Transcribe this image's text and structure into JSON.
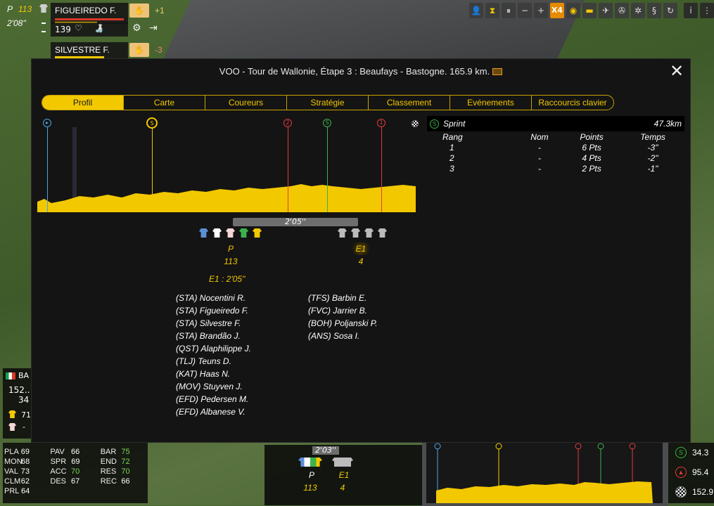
{
  "hud": {
    "group_label": "P",
    "group_count": "113",
    "gap_time": "2'08''",
    "rider1_name": "FIGUEIREDO F.",
    "rider1_delta": "+1",
    "rider1_energy": "139",
    "rider2_name": "SILVESTRE F.",
    "rider2_delta": "-3"
  },
  "toolbar": {
    "speed_label": "X4"
  },
  "dialog": {
    "title": "VOO - Tour de Wallonie, Étape 3 : Beaufays - Bastogne. 165.9 km."
  },
  "tabs": [
    {
      "label": "Profil",
      "active": true
    },
    {
      "label": "Carte",
      "active": false
    },
    {
      "label": "Coureurs",
      "active": false
    },
    {
      "label": "Stratégie",
      "active": false
    },
    {
      "label": "Classement",
      "active": false
    },
    {
      "label": "Evénements",
      "active": false
    },
    {
      "label": "Raccourcis clavier",
      "active": false
    }
  ],
  "profile": {
    "markers": [
      {
        "glyph": "▸",
        "color": "#4aa3e0"
      },
      {
        "glyph": "S",
        "color": "#f2c800"
      },
      {
        "glyph": "2",
        "color": "#e23b3b"
      },
      {
        "glyph": "S",
        "color": "#3bb34a"
      },
      {
        "glyph": "1",
        "color": "#e23b3b"
      }
    ],
    "gap_bar": "2'05''",
    "group_p_label": "P",
    "group_p_count": "113",
    "group_e1_label": "E1",
    "group_e1_count": "4",
    "e1_caption": "E1 : 2'05''",
    "group_p_jersey_colors": [
      "#5b8fd4",
      "#ffffff",
      "#f4d6d6",
      "#3bb34a",
      "#f2c800"
    ],
    "group_e1_jersey_colors": [
      "#bbbbbb",
      "#bbbbbb",
      "#bbbbbb",
      "#bbbbbb"
    ]
  },
  "riders_left": [
    "(STA) Nocentini R.",
    "(STA) Figueiredo F.",
    "(STA) Silvestre F.",
    "(STA) Brandão J.",
    "(QST) Alaphilippe J.",
    "(TLJ) Teuns D.",
    "(KAT) Haas N.",
    "(MOV) Stuyven J.",
    "(EFD) Pedersen M.",
    "(EFD) Albanese V."
  ],
  "riders_right": [
    "(TFS) Barbin E.",
    "(FVC) Jarrier B.",
    "(BOH) Poljanski P.",
    "(ANS) Sosa I."
  ],
  "sprint": {
    "title": "Sprint",
    "km": "47.3km",
    "headers": [
      "Rang",
      "Nom",
      "Points",
      "Temps"
    ],
    "rows": [
      [
        "1",
        "-",
        "6 Pts",
        "-3''"
      ],
      [
        "2",
        "-",
        "4 Pts",
        "-2''"
      ],
      [
        "3",
        "-",
        "2 Pts",
        "-1''"
      ]
    ]
  },
  "left_panel": {
    "flag_code": "BA",
    "value1": "152..",
    "value2": "34",
    "yellow_count": "71",
    "dash": "-"
  },
  "stats": [
    [
      [
        "PLA",
        "69"
      ],
      [
        "PAV",
        "66"
      ],
      [
        "BAR",
        "75"
      ]
    ],
    [
      [
        "MON",
        "68"
      ],
      [
        "SPR",
        "69"
      ],
      [
        "END",
        "72"
      ]
    ],
    [
      [
        "VAL",
        "73"
      ],
      [
        "ACC",
        "70"
      ],
      [
        "RES",
        "70"
      ]
    ],
    [
      [
        "CLM",
        "62"
      ],
      [
        "DES",
        "67"
      ],
      [
        "REC",
        "66"
      ]
    ],
    [
      [
        "PRL",
        "64"
      ]
    ]
  ],
  "bottom_center": {
    "gap": "2'03''",
    "p_label": "P",
    "p_count": "113",
    "e1_label": "E1",
    "e1_count": "4"
  },
  "bottom_right": {
    "sprint_dist": "34.3",
    "climb_dist": "95.4",
    "finish_dist": "152.9"
  }
}
